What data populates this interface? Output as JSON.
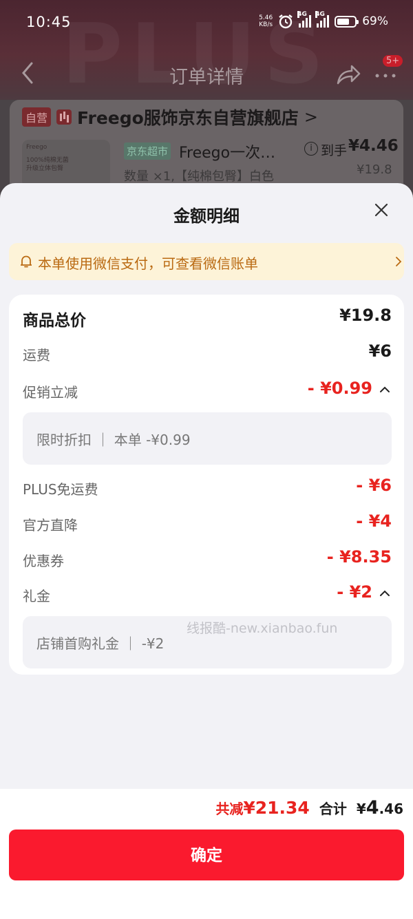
{
  "status_bar": {
    "time": "10:45",
    "net_speed_value": "5.46",
    "net_speed_unit": "KB/s",
    "signal_1_label": "4G",
    "signal_2_label": "4G",
    "battery_percent": "69%"
  },
  "nav": {
    "title": "订单详情",
    "badge": "5+"
  },
  "background_order": {
    "self_operated_tag": "自营",
    "store_name": "Freego服饰京东自营旗舰店",
    "store_arrow": ">",
    "product_image_text_1": "Freego",
    "product_image_text_2": "100%纯棉无菌",
    "product_image_text_3": "升级立体包臀",
    "supermarket_tag": "京东超市",
    "product_name": "Freego一次…",
    "price_prefix": "到手",
    "final_price": "¥4.46",
    "original_price": "¥19.8",
    "spec": "数量 ×1,【纯棉包臀】白色"
  },
  "sheet": {
    "title": "金额明细",
    "notice": "本单使用微信支付，可查看微信账单",
    "rows": {
      "total_goods": {
        "label": "商品总价",
        "value": "¥19.8"
      },
      "shipping": {
        "label": "运费",
        "value": "¥6"
      },
      "promo": {
        "label": "促销立减",
        "value": "- ¥0.99",
        "detail": "限时折扣 ｜ 本单 -¥0.99"
      },
      "plus_shipping": {
        "label": "PLUS免运费",
        "value": "- ¥6"
      },
      "official_drop": {
        "label": "官方直降",
        "value": "- ¥4"
      },
      "coupon": {
        "label": "优惠券",
        "value": "- ¥8.35"
      },
      "gift": {
        "label": "礼金",
        "value": "- ¥2",
        "detail": "店铺首购礼金 ｜ -¥2"
      }
    },
    "watermark": "线报酷-new.xianbao.fun"
  },
  "bottom": {
    "saved_label": "共减",
    "saved_value": "¥21.34",
    "total_label": "合计",
    "total_currency": "¥",
    "total_int": "4",
    "total_dec": ".46",
    "confirm_label": "确定"
  },
  "colors": {
    "accent_red": "#e8231f",
    "button_red": "#fa1a2e",
    "notice_bg": "#fdf3d8",
    "notice_text": "#ba6a12"
  }
}
